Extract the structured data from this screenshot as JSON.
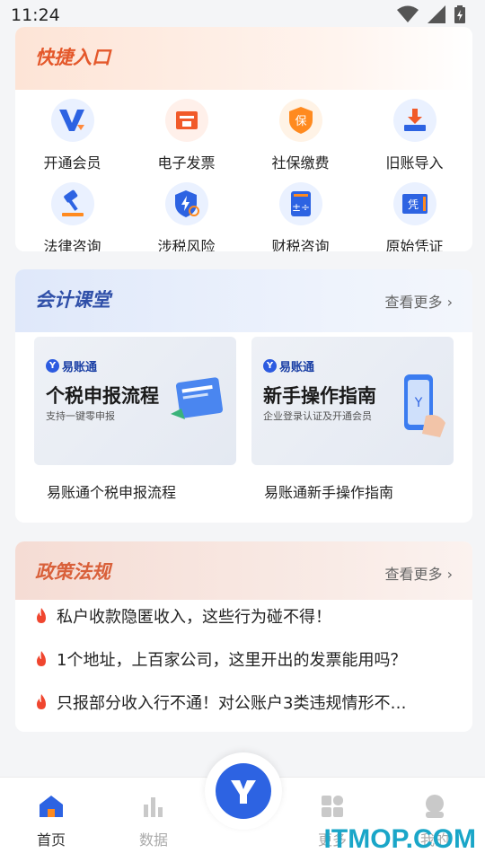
{
  "status_bar": {
    "time": "11:24"
  },
  "quick_entry": {
    "title": "快捷入口",
    "items": [
      {
        "label": "开通会员",
        "icon": "vip-icon"
      },
      {
        "label": "电子发票",
        "icon": "invoice-icon"
      },
      {
        "label": "社保缴费",
        "icon": "social-security-icon"
      },
      {
        "label": "旧账导入",
        "icon": "import-icon"
      },
      {
        "label": "法律咨询",
        "icon": "gavel-icon"
      },
      {
        "label": "涉税风险",
        "icon": "tax-risk-icon"
      },
      {
        "label": "财税咨询",
        "icon": "calculator-icon"
      },
      {
        "label": "原始凭证",
        "icon": "voucher-icon"
      }
    ]
  },
  "course": {
    "title": "会计课堂",
    "more": "查看更多",
    "items": [
      {
        "logo": "易账通",
        "thumb_title": "个税申报流程",
        "thumb_sub": "支持一键零申报",
        "caption": "易账通个税申报流程"
      },
      {
        "logo": "易账通",
        "thumb_title": "新手操作指南",
        "thumb_sub": "企业登录认证及开通会员",
        "caption": "易账通新手操作指南"
      }
    ]
  },
  "policy": {
    "title": "政策法规",
    "more": "查看更多",
    "items": [
      "私户收款隐匿收入，这些行为碰不得！",
      "1个地址，上百家公司，这里开出的发票能用吗？",
      "只报部分收入行不通！对公账户3类违规情形不…"
    ]
  },
  "tabbar": {
    "tabs": [
      {
        "label": "首页",
        "icon": "home-icon",
        "active": true
      },
      {
        "label": "数据",
        "icon": "chart-icon",
        "active": false
      },
      {
        "label": "更多",
        "icon": "grid-icon",
        "active": false
      },
      {
        "label": "我的",
        "icon": "profile-icon",
        "active": false
      }
    ],
    "center_icon": "app-logo-icon"
  },
  "watermark": "ITMOP.COM",
  "colors": {
    "accent": "#2d63e2",
    "quick_title": "#e4582b",
    "course_title": "#2f4fa8",
    "policy_title": "#d9603a"
  }
}
